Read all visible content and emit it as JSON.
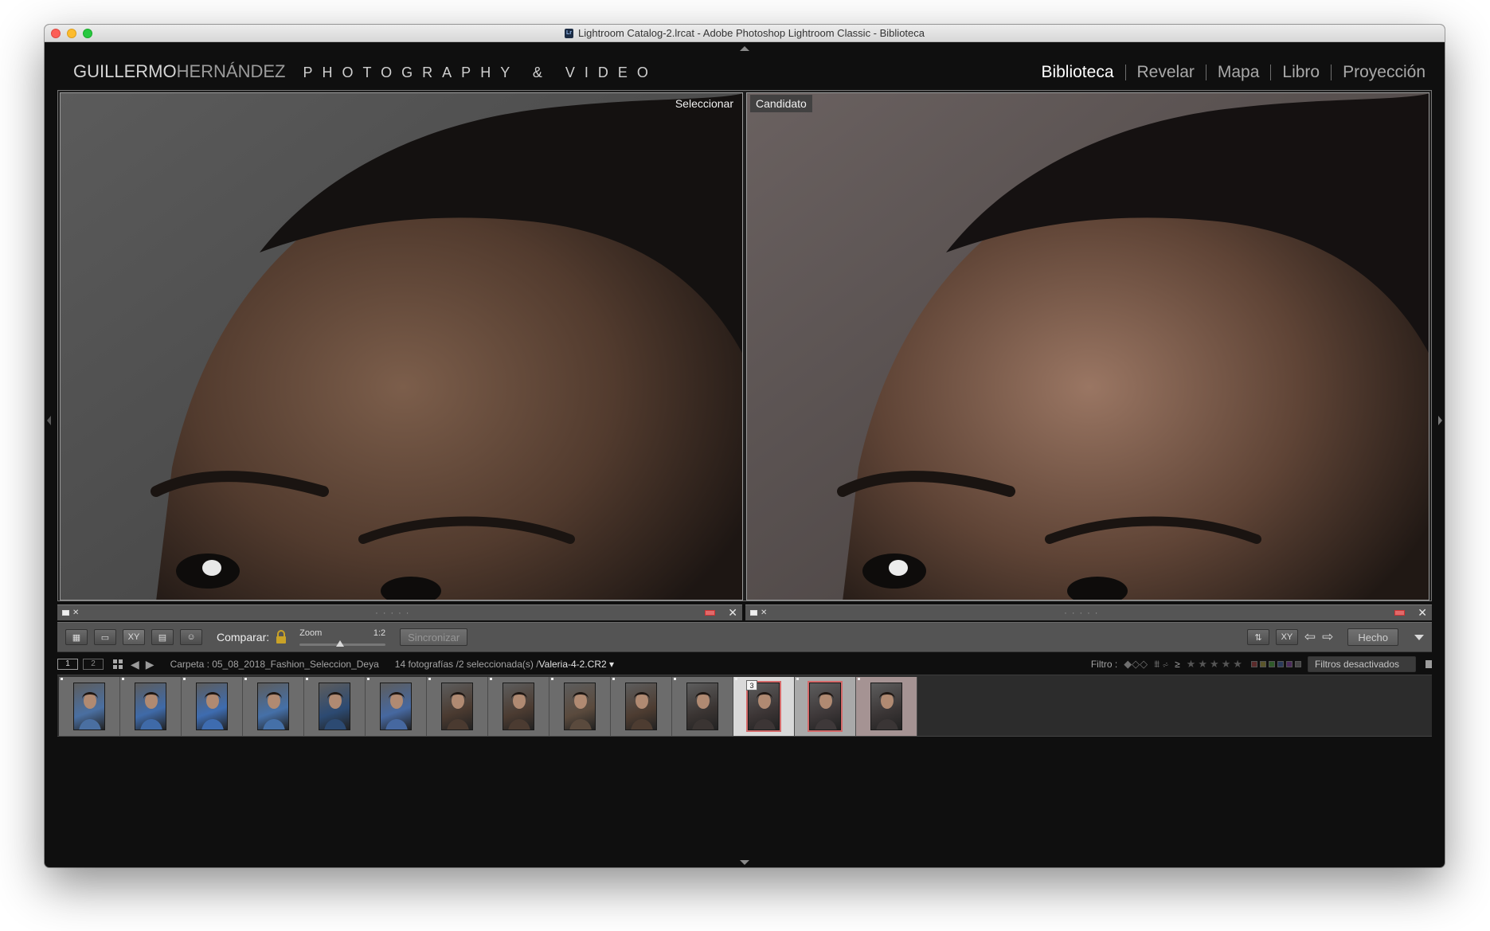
{
  "window": {
    "title": "Lightroom Catalog-2.lrcat - Adobe Photoshop Lightroom Classic - Biblioteca",
    "app_icon_text": "Lr"
  },
  "identity_plate": {
    "name_a": "GUILLERMO",
    "name_b": "HERNÁNDEZ",
    "tagline": "PHOTOGRAPHY & VIDEO"
  },
  "modules": [
    {
      "label": "Biblioteca",
      "active": true
    },
    {
      "label": "Revelar",
      "active": false
    },
    {
      "label": "Mapa",
      "active": false
    },
    {
      "label": "Libro",
      "active": false
    },
    {
      "label": "Proyección",
      "active": false
    }
  ],
  "compare": {
    "select_label": "Seleccionar",
    "candidate_label": "Candidato"
  },
  "toolbar": {
    "compare_label": "Comparar:",
    "zoom_label": "Zoom",
    "zoom_value": "1:2",
    "sync_label": "Sincronizar",
    "done_label": "Hecho",
    "xy_label": "XY"
  },
  "filmstrip_nav": {
    "monitor_1": "1",
    "monitor_2": "2",
    "source": "Carpeta : 05_08_2018_Fashion_Seleccion_Deya",
    "count": "14 fotografías /2 seleccionada(s) /",
    "filename": "Valeria-4-2.CR2 ▾",
    "filter_label": "Filtro :",
    "rating_op": "≥",
    "stars": "★★★★★",
    "filter_select": "Filtros desactivados"
  },
  "filmstrip": {
    "badge_number": "3",
    "thumbnail_count": 14
  },
  "colors": {
    "active_module": "#ffffff",
    "inactive_module": "#a9a9a9",
    "candidate_outline": "#d46a6a"
  }
}
